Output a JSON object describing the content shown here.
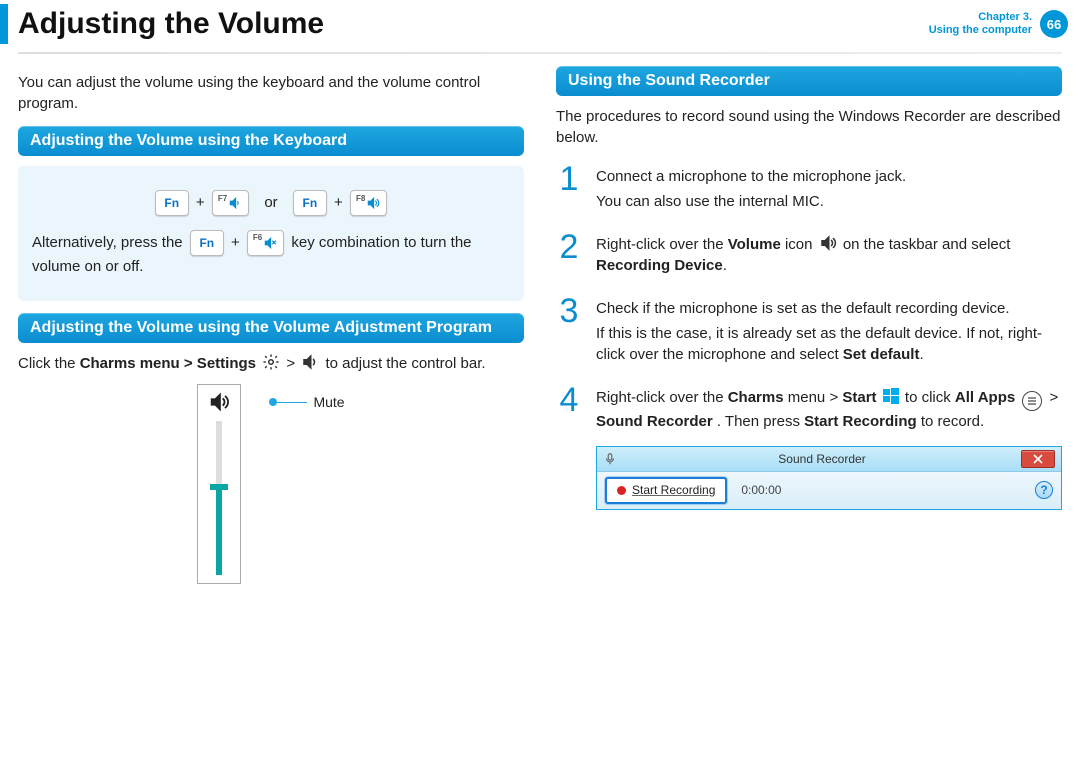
{
  "header": {
    "title": "Adjusting the Volume",
    "chapter_line1": "Chapter 3.",
    "chapter_line2": "Using the computer",
    "page_number": "66"
  },
  "left": {
    "intro": "You can adjust the volume using the keyboard and the volume control program.",
    "sec1_title": "Adjusting the Volume using the Keyboard",
    "fn": "Fn",
    "f7": "F7",
    "f8": "F8",
    "f6": "F6",
    "or": "or",
    "alt_pre": "Alternatively, press the ",
    "plus": "+",
    "alt_post": " key combination to turn the volume on or off.",
    "sec2_title": "Adjusting the Volume using the Volume Adjustment Program",
    "charms_pre": "Click the ",
    "charms_bold": "Charms menu > Settings",
    "charms_post": " to adjust the control bar.",
    "gt": ">",
    "mute": "Mute"
  },
  "right": {
    "sec_title": "Using the Sound Recorder",
    "intro": "The procedures to record sound using the Windows Recorder are described below.",
    "steps": {
      "s1n": "1",
      "s1a": "Connect a microphone to the microphone jack.",
      "s1b": "You can also use the internal MIC.",
      "s2n": "2",
      "s2a_pre": "Right-click over the ",
      "s2a_b1": "Volume",
      "s2a_mid": " icon ",
      "s2a_post": " on the taskbar and select ",
      "s2a_b2": "Recording Device",
      "s2a_end": ".",
      "s3n": "3",
      "s3a": "Check if the microphone is set as the default recording device.",
      "s3b_pre": "If this is the case, it is already set as the default device. If not, right-click over the microphone and select ",
      "s3b_b": "Set default",
      "s3b_end": ".",
      "s4n": "4",
      "s4a_pre": "Right-click over the ",
      "s4a_b1": "Charms",
      "s4a_mid1": " menu > ",
      "s4a_b2": "Start",
      "s4a_mid2": " to click ",
      "s4a_b3": "All Apps",
      "s4b_mid": " > ",
      "s4b_b1": "Sound Recorder",
      "s4b_mid2": ". Then press ",
      "s4b_b2": "Start Recording",
      "s4b_end": " to record."
    },
    "recorder": {
      "title": "Sound Recorder",
      "button": "Start Recording",
      "time": "0:00:00",
      "help": "?"
    }
  }
}
